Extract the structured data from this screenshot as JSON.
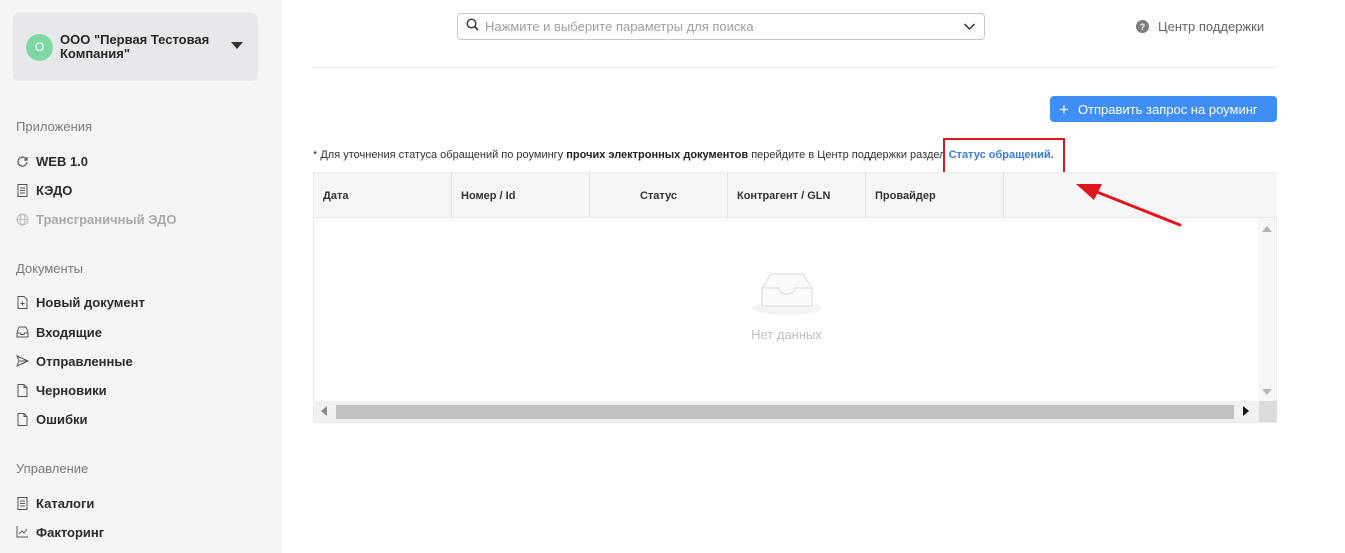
{
  "org": {
    "avatar_letter": "О",
    "name": "ООО \"Первая Тестовая Компания\""
  },
  "sidebar": {
    "sections": {
      "apps": "Приложения",
      "documents": "Документы",
      "management": "Управление"
    },
    "apps": [
      {
        "label": "WEB 1.0",
        "icon": "refresh-icon"
      },
      {
        "label": "КЭДО",
        "icon": "document-list-icon"
      },
      {
        "label": "Трансграничный ЭДО",
        "icon": "globe-icon"
      }
    ],
    "documents": [
      {
        "label": "Новый документ",
        "icon": "new-document-icon"
      },
      {
        "label": "Входящие",
        "icon": "inbox-icon"
      },
      {
        "label": "Отправленные",
        "icon": "send-icon"
      },
      {
        "label": "Черновики",
        "icon": "draft-icon"
      },
      {
        "label": "Ошибки",
        "icon": "error-document-icon"
      }
    ],
    "management": [
      {
        "label": "Каталоги",
        "icon": "catalog-icon"
      },
      {
        "label": "Факторинг",
        "icon": "chart-icon"
      }
    ]
  },
  "search": {
    "placeholder": "Нажмите и выберите параметры для поиска"
  },
  "support": {
    "label": "Центр поддержки"
  },
  "roaming_button": {
    "label": "Отправить запрос на роуминг"
  },
  "note": {
    "prefix": "* Для уточнения статуса обращений по роумингу ",
    "bold": "прочих электронных документов",
    "middle": " перейдите в Центр поддержки раздел ",
    "link": "Статус обращений."
  },
  "table": {
    "columns": [
      "Дата",
      "Номер / Id",
      "Статус",
      "Контрагент / GLN",
      "Провайдер"
    ],
    "empty_text": "Нет данных"
  },
  "colors": {
    "accent": "#3f8ef5",
    "highlight": "#e1161c",
    "link": "#3a7be0"
  }
}
